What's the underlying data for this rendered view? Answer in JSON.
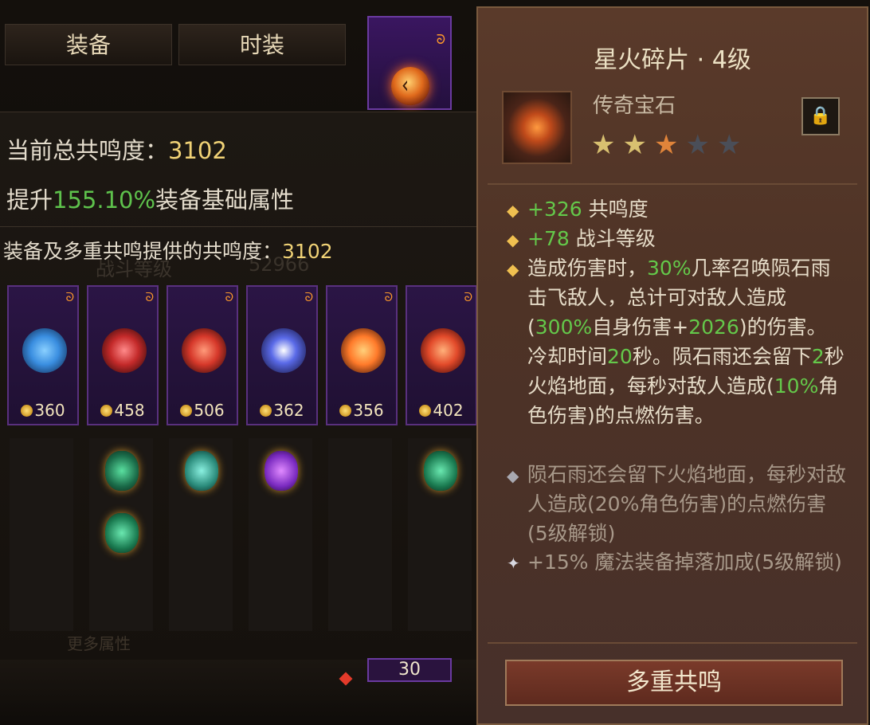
{
  "left": {
    "total_resonance_label": "当前总共鸣度：",
    "total_resonance_value": "3102",
    "boost_prefix": "提升",
    "boost_pct": "155.10%",
    "boost_suffix": "装备基础属性",
    "provided_label": "装备及多重共鸣提供的共鸣度：",
    "provided_value": "3102",
    "ghost_combat_label": "战斗等级",
    "ghost_combat_value": "52966",
    "more_attr_label": "更多属性",
    "equipment": [
      {
        "cost": "360",
        "gem_color": "#3a8ee0"
      },
      {
        "cost": "458",
        "gem_color": "#c42a2a"
      },
      {
        "cost": "506",
        "gem_color": "#d6382a"
      },
      {
        "cost": "362",
        "gem_color": "#5a6ae8"
      },
      {
        "cost": "356",
        "gem_color": "#ff7a2a"
      },
      {
        "cost": "402",
        "gem_color": "#e24a2a"
      }
    ],
    "tabs": {
      "equip": "装备",
      "fashion": "时装"
    },
    "level_badge": "30"
  },
  "tooltip": {
    "title": "星火碎片 · 4级",
    "gem_type": "传奇宝石",
    "stars": [
      "gold",
      "gold",
      "orange",
      "grey",
      "grey"
    ],
    "attr1_value": "+326",
    "attr1_label": " 共鸣度",
    "attr2_value": "+78",
    "attr2_label": " 战斗等级",
    "effect": {
      "p1": "造成伤害时，",
      "g1": "30%",
      "p2": "几率召唤陨石雨击飞敌人，总计可对敌人造成(",
      "g2": "300%",
      "p3": "自身伤害+",
      "g3": "2026",
      "p4": ")的伤害。冷却时间",
      "g4": "20",
      "p5": "秒。陨石雨还会留下",
      "g5": "2",
      "p6": "秒火焰地面，每秒对敌人造成(",
      "g6": "10%",
      "p7": "角色伤害)的点燃伤害。"
    },
    "locked1": "陨石雨还会留下火焰地面，每秒对敌人造成(20%角色伤害)的点燃伤害(5级解锁)",
    "locked2": "+15% 魔法装备掉落加成(5级解锁)",
    "action_label": "多重共鸣"
  },
  "colors": {
    "green": "#64c84a",
    "gold": "#f0d276"
  }
}
